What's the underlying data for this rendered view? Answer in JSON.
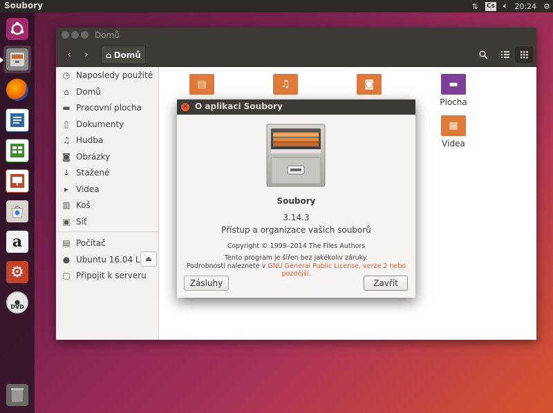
{
  "top_panel": {
    "title": "Soubory",
    "keyboard_layout": "Cs",
    "time": "20:24"
  },
  "launcher": {
    "items": [
      {
        "name": "dash-home",
        "icon": "ubuntu-logo-icon",
        "color": "#a02a6a"
      },
      {
        "name": "files",
        "icon": "file-cabinet-icon",
        "color": "#8a8884"
      },
      {
        "name": "firefox",
        "icon": "firefox-icon",
        "color": "#e66000"
      },
      {
        "name": "writer",
        "icon": "libreoffice-writer-icon",
        "color": "#2a6aa8"
      },
      {
        "name": "calc",
        "icon": "libreoffice-calc-icon",
        "color": "#3d8c33"
      },
      {
        "name": "impress",
        "icon": "libreoffice-impress-icon",
        "color": "#c6462a"
      },
      {
        "name": "software",
        "icon": "software-center-icon",
        "color": "#d9d4cc"
      },
      {
        "name": "amazon",
        "icon": "amazon-icon",
        "color": "#f2f2f2"
      },
      {
        "name": "settings",
        "icon": "system-settings-icon",
        "color": "#c2422a"
      },
      {
        "name": "dvd",
        "icon": "dvd-icon",
        "color": "#e8e8e8"
      },
      {
        "name": "trash",
        "icon": "trash-icon",
        "color": "#6a6864"
      }
    ]
  },
  "window": {
    "title": "Domů",
    "breadcrumb": "Domů"
  },
  "sidebar": {
    "items": [
      {
        "label": "Naposledy použité",
        "icon": "clock-icon"
      },
      {
        "label": "Domů",
        "icon": "home-icon"
      },
      {
        "label": "Pracovní plocha",
        "icon": "desktop-folder-icon"
      },
      {
        "label": "Dokumenty",
        "icon": "document-icon"
      },
      {
        "label": "Hudba",
        "icon": "music-icon"
      },
      {
        "label": "Obrázky",
        "icon": "camera-icon"
      },
      {
        "label": "Stažené",
        "icon": "download-icon"
      },
      {
        "label": "Videa",
        "icon": "video-icon"
      },
      {
        "label": "Koš",
        "icon": "trash-icon"
      },
      {
        "label": "Síť",
        "icon": "network-icon"
      },
      {
        "label": "Počítač",
        "icon": "computer-icon"
      },
      {
        "label": "Ubuntu 16.04 L...",
        "icon": "disc-icon"
      },
      {
        "label": "Připojit k serveru",
        "icon": "connect-server-icon"
      }
    ]
  },
  "content": {
    "folders": [
      {
        "label": "Plocha",
        "icon": "desktop-folder-icon",
        "color": "#7d3f98"
      },
      {
        "label": "Videa",
        "icon": "video-folder-icon",
        "color": "#e07a3a"
      }
    ]
  },
  "dialog": {
    "title": "O aplikaci Soubory",
    "app_name": "Soubory",
    "version": "3.14.3",
    "description": "Přístup a organizace vašich souborů",
    "copyright": "Copyright © 1999–2014 The Files Authors",
    "warranty": "Tento program je šířen bez jakékoliv záruky.",
    "license_prefix": "Podrobnosti naleznete v ",
    "license_link": "GNU General Public License, verze 2 nebo pozdější",
    "license_suffix": ".",
    "credits_button": "Zásluhy",
    "close_button": "Zavřít"
  },
  "colors": {
    "accent": "#e5582b",
    "panel": "#2c2a26",
    "titlebar": "#3c3b37"
  }
}
